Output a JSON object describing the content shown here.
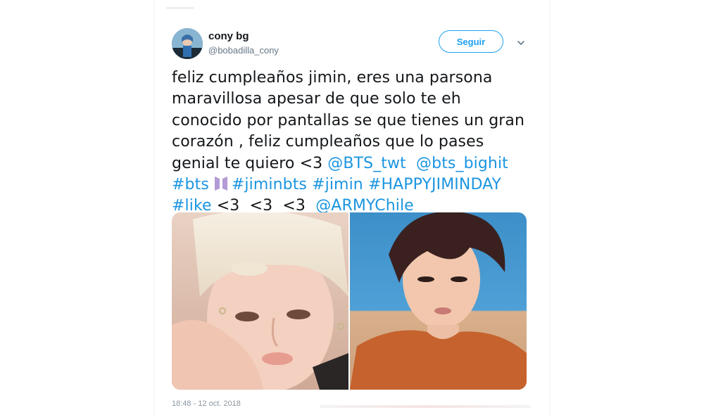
{
  "user": {
    "display_name": "cony bg",
    "handle": "@bobadilla_cony"
  },
  "follow_label": "Seguir",
  "tweet": {
    "lines": [
      [
        {
          "t": "feliz cumpleaños jimin, eres una parsona",
          "link": false
        }
      ],
      [
        {
          "t": "maravillosa apesar de que solo te eh",
          "link": false
        }
      ],
      [
        {
          "t": "conocido por pantallas se que tienes un gran",
          "link": false
        }
      ],
      [
        {
          "t": "corazón , feliz cumpleaños que lo pases",
          "link": false
        }
      ],
      [
        {
          "t": "genial te quiero <3 ",
          "link": false
        },
        {
          "t": "@BTS_twt",
          "link": true
        },
        {
          "t": "  ",
          "link": false
        },
        {
          "t": "@bts_bighit",
          "link": true
        }
      ],
      [
        {
          "t": "#bts",
          "link": true
        },
        {
          "emoji": "bts-logo-icon"
        },
        {
          "t": "#jiminbts",
          "link": true
        },
        {
          "t": " ",
          "link": false
        },
        {
          "t": "#jimin",
          "link": true
        },
        {
          "t": " ",
          "link": false
        },
        {
          "t": "#HAPPYJIMINDAY",
          "link": true
        }
      ],
      [
        {
          "t": "#like",
          "link": true
        },
        {
          "t": " <3  <3  <3  ",
          "link": false
        },
        {
          "t": "@ARMYChile",
          "link": true
        }
      ]
    ]
  },
  "timestamp": "18:48 - 12 oct. 2018",
  "colors": {
    "link": "#1b95e0",
    "follow_border": "#1da1f2",
    "text": "#14171a",
    "muted": "#657786"
  },
  "icons": {
    "chevron": "chevron-down-icon",
    "emoji": "bts-logo-icon"
  }
}
